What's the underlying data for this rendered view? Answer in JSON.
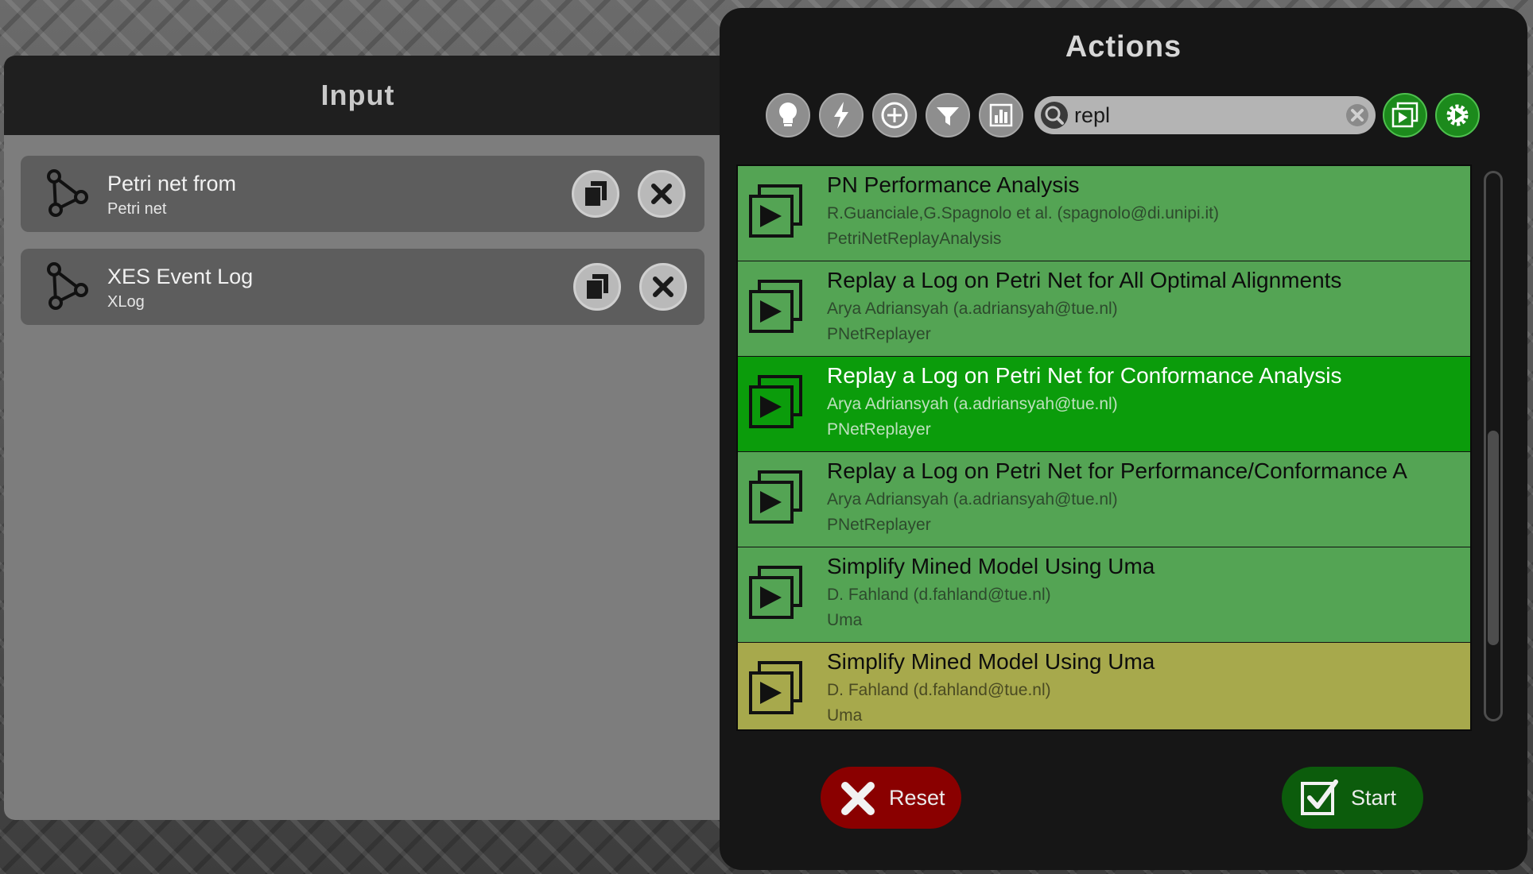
{
  "input": {
    "title": "Input",
    "items": [
      {
        "name": "Petri net from",
        "type": "Petri net",
        "icon": "graph-icon"
      },
      {
        "name": "XES Event Log",
        "type": "XLog",
        "icon": "graph-icon"
      }
    ]
  },
  "actions": {
    "title": "Actions",
    "toolbar": [
      "lightbulb-icon",
      "lightning-icon",
      "plus-circle-icon",
      "filter-icon",
      "bar-chart-icon"
    ],
    "search": {
      "value": "repl",
      "placeholder": ""
    },
    "list": [
      {
        "title": "PN Performance Analysis",
        "author": "R.Guanciale,G.Spagnolo et al. (spagnolo@di.unipi.it)",
        "package": "PetriNetReplayAnalysis",
        "state": "normal"
      },
      {
        "title": "Replay a Log on Petri Net for All Optimal Alignments",
        "author": "Arya Adriansyah (a.adriansyah@tue.nl)",
        "package": "PNetReplayer",
        "state": "normal"
      },
      {
        "title": "Replay a Log on Petri Net for Conformance Analysis",
        "author": "Arya Adriansyah (a.adriansyah@tue.nl)",
        "package": "PNetReplayer",
        "state": "selected"
      },
      {
        "title": "Replay a Log on Petri Net for Performance/Conformance A",
        "author": "Arya Adriansyah (a.adriansyah@tue.nl)",
        "package": "PNetReplayer",
        "state": "normal"
      },
      {
        "title": "Simplify Mined Model Using Uma",
        "author": "D. Fahland (d.fahland@tue.nl)",
        "package": "Uma",
        "state": "normal"
      },
      {
        "title": "Simplify Mined Model Using Uma",
        "author": "D. Fahland (d.fahland@tue.nl)",
        "package": "Uma",
        "state": "partial"
      }
    ],
    "reset_label": "Reset",
    "start_label": "Start"
  },
  "colors": {
    "row_green": "#54a454",
    "row_selected": "#0b9c0b",
    "row_partial": "#a7a94c",
    "reset_red": "#8a0000",
    "start_green": "#0c5c0c"
  }
}
